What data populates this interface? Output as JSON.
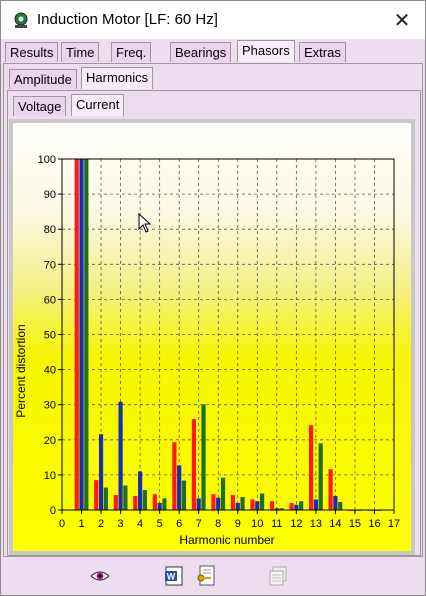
{
  "window": {
    "title": "Induction Motor   [LF: 60 Hz]"
  },
  "main_tabs": [
    "Results",
    "Time",
    "Freq.",
    "Bearings",
    "Phasors",
    "Extras"
  ],
  "main_tab_active": "Phasors",
  "sub_tabs": [
    "Amplitude",
    "Harmonics"
  ],
  "sub_tab_active": "Harmonics",
  "sub_sub_tabs": [
    "Voltage",
    "Current"
  ],
  "sub_sub_tab_active": "Current",
  "colors": {
    "red": "#ff1a1a",
    "blue": "#1a2fb0",
    "green": "#1f6e1f"
  },
  "icons": [
    "eye-icon",
    "word-export-icon",
    "key-document-icon",
    "copy-pages-icon"
  ],
  "chart_data": {
    "type": "bar",
    "xlabel": "Harmonic number",
    "ylabel": "Percent distortion",
    "xlim": [
      0,
      17
    ],
    "ylim": [
      0,
      100
    ],
    "xticks": [
      0,
      1,
      2,
      3,
      4,
      5,
      6,
      7,
      8,
      9,
      10,
      11,
      12,
      13,
      14,
      15,
      16,
      17
    ],
    "yticks": [
      0,
      10,
      20,
      30,
      40,
      50,
      60,
      70,
      80,
      90,
      100
    ],
    "grid": true,
    "categories": [
      1,
      2,
      3,
      4,
      5,
      6,
      7,
      8,
      9,
      10,
      11,
      12,
      13,
      14,
      15,
      16
    ],
    "series": [
      {
        "color": "#ff1a1a",
        "values": [
          100,
          8.5,
          4.3,
          4,
          4.5,
          19.3,
          25.9,
          4.5,
          4.3,
          3,
          2.5,
          2,
          24.2,
          11.6,
          0,
          0
        ]
      },
      {
        "color": "#1a2fb0",
        "values": [
          100,
          21.6,
          30.8,
          11,
          2,
          12.7,
          3.3,
          3.5,
          2,
          2.5,
          0.5,
          1.5,
          3,
          4,
          0,
          0
        ]
      },
      {
        "color": "#1f6e1f",
        "values": [
          100,
          6.4,
          7,
          5.7,
          3.3,
          8.4,
          30.1,
          9.2,
          3.7,
          4.7,
          0.5,
          2.5,
          19,
          2.3,
          0,
          0
        ]
      }
    ]
  }
}
